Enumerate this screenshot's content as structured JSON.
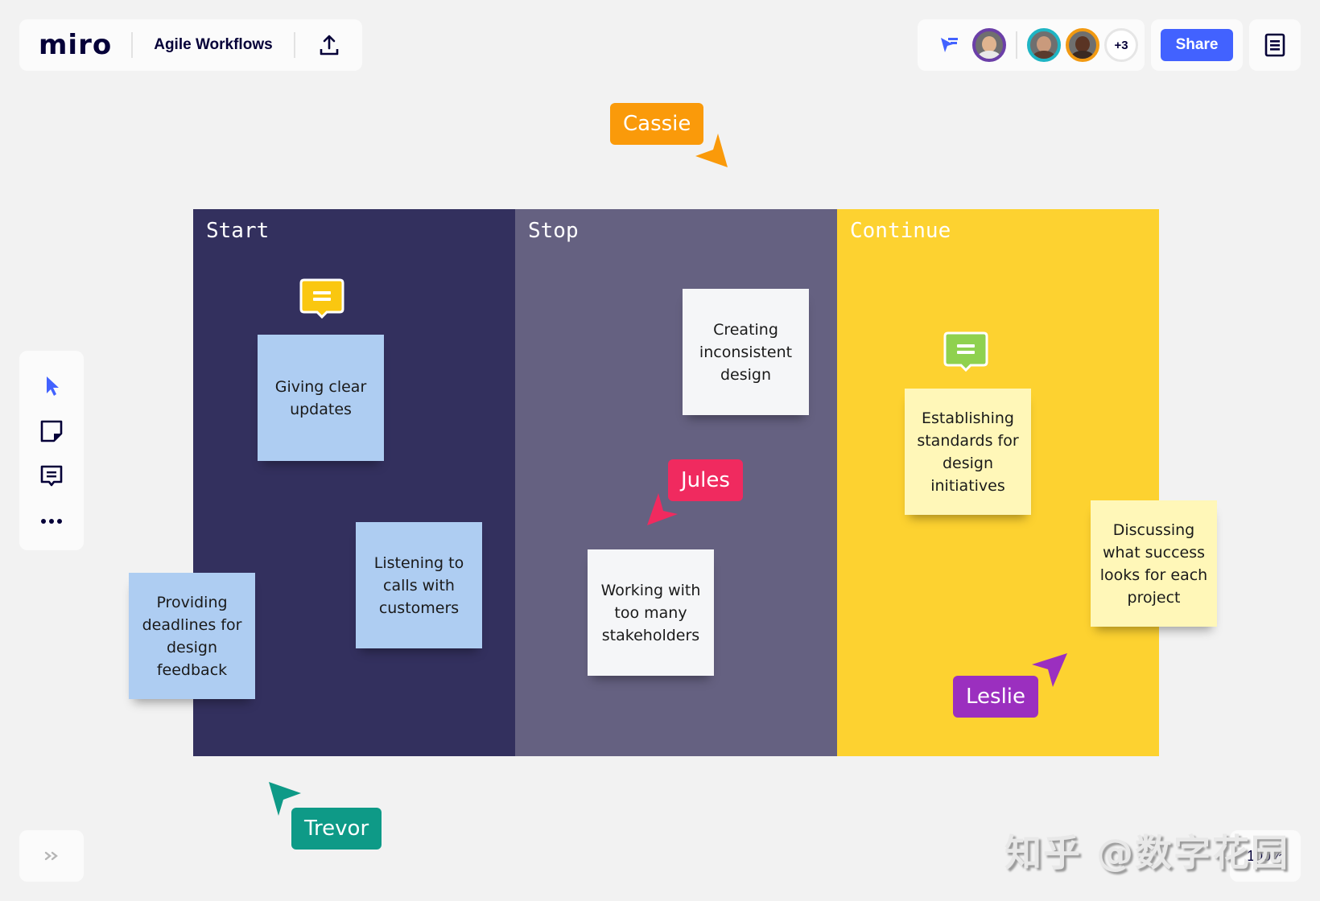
{
  "app": {
    "logo": "miro",
    "board_title": "Agile Workflows"
  },
  "header": {
    "upload_icon": "upload-icon",
    "collaborators": [
      {
        "name": "current-user",
        "ring_color": "#6b3fa8",
        "skin": "#e0b48f",
        "shirt": "#e8e8e8"
      },
      {
        "name": "collaborator-1",
        "ring_color": "#1fb5c4",
        "skin": "#c99a7c",
        "shirt": "#5a3b2e"
      },
      {
        "name": "collaborator-2",
        "ring_color": "#f29a12",
        "skin": "#5a3424",
        "shirt": "#3a2a22"
      }
    ],
    "more_count": "+3",
    "share_label": "Share",
    "notes_icon": "notes-icon"
  },
  "toolbar": {
    "tools": [
      {
        "name": "select-tool",
        "icon": "cursor-icon"
      },
      {
        "name": "sticky-note-tool",
        "icon": "sticky-note-icon"
      },
      {
        "name": "comment-tool",
        "icon": "comment-icon"
      },
      {
        "name": "more-tools",
        "icon": "more-icon"
      }
    ]
  },
  "board": {
    "columns": [
      {
        "title": "Start",
        "color": "#33305e"
      },
      {
        "title": "Stop",
        "color": "#656181"
      },
      {
        "title": "Continue",
        "color": "#fdd230"
      }
    ],
    "stickies": [
      {
        "text": "Giving clear updates",
        "color": "#aecdf2",
        "column": "Start"
      },
      {
        "text": "Listening to calls with customers",
        "color": "#aecdf2",
        "column": "Start"
      },
      {
        "text": "Providing deadlines for design feedback",
        "color": "#aecdf2",
        "column": "Start"
      },
      {
        "text": "Creating inconsistent design",
        "color": "#f5f6f8",
        "column": "Stop"
      },
      {
        "text": "Working with too many stakeholders",
        "color": "#f5f6f8",
        "column": "Stop"
      },
      {
        "text": "Establishing standards for design initiatives",
        "color": "#fff7b8",
        "column": "Continue"
      },
      {
        "text": "Discussing what success looks for each project",
        "color": "#fff7b8",
        "column": "Continue"
      }
    ],
    "comments": [
      {
        "color": "#fac710"
      },
      {
        "color": "#8fd14f"
      }
    ]
  },
  "cursors": [
    {
      "name": "Cassie",
      "color": "#fa9a0a"
    },
    {
      "name": "Jules",
      "color": "#f02a5f"
    },
    {
      "name": "Leslie",
      "color": "#9b2fbf"
    },
    {
      "name": "Trevor",
      "color": "#0e9a87"
    }
  ],
  "footer": {
    "zoom_level": "100%"
  },
  "watermark": "知乎 @数字花园"
}
